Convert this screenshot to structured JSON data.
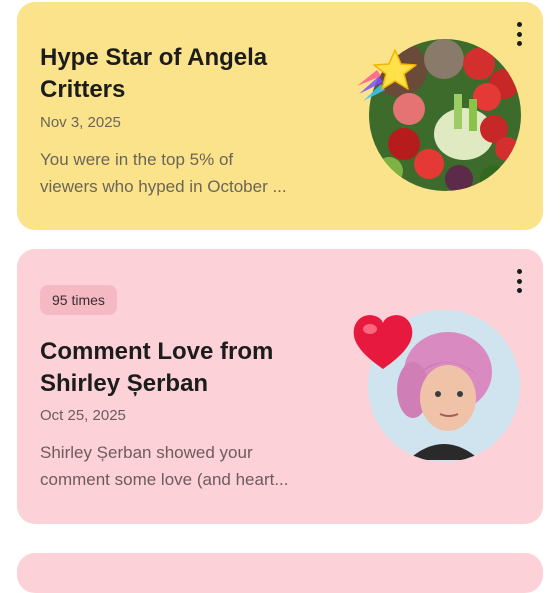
{
  "cards": [
    {
      "title": "Hype Star of Angela\nCritters",
      "date": "Nov 3, 2025",
      "description": "You were in the top 5% of\nviewers who hyped in October ...",
      "sticker": "shooting-star-icon",
      "image": "vegetables-thumbnail",
      "color": "#fbe38c"
    },
    {
      "pill": "95 times",
      "title": "Comment Love from\nShirley Șerban",
      "date": "Oct 25, 2025",
      "description": "Shirley Șerban showed your\ncomment some love (and heart...",
      "sticker": "heart-icon",
      "image": "avatar-photo",
      "color": "#fcd1d8"
    }
  ]
}
